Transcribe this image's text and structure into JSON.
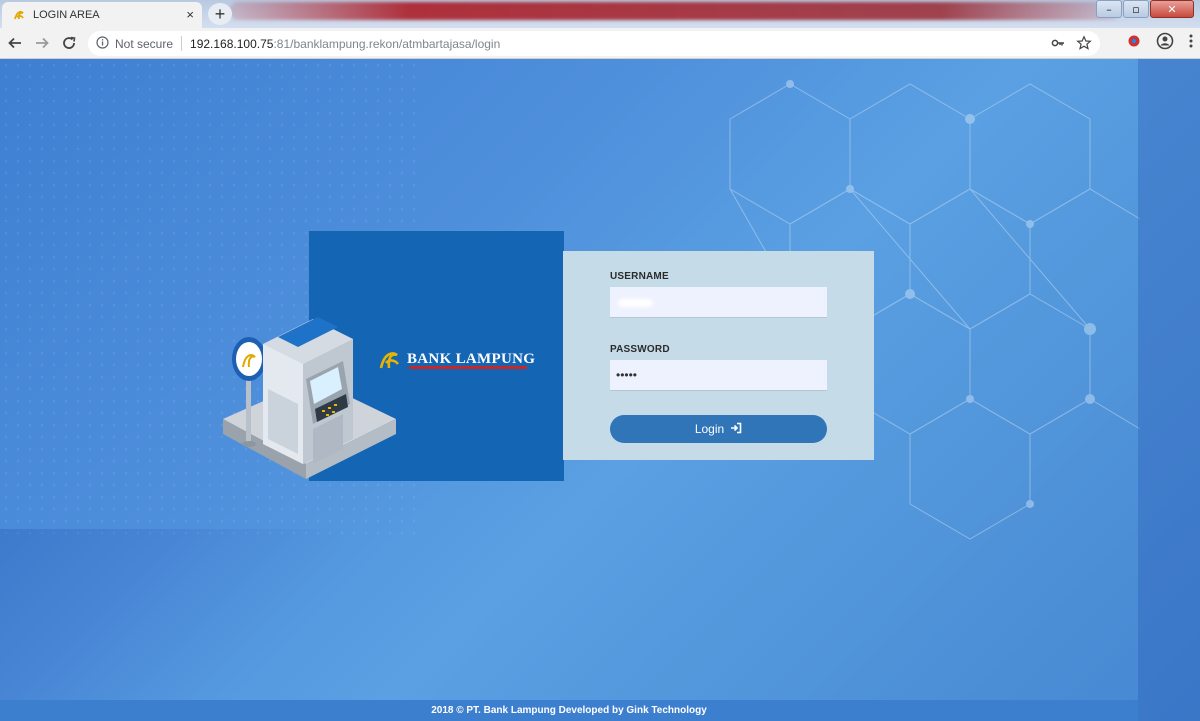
{
  "browser": {
    "tab_title": "LOGIN AREA",
    "tab_close": "×",
    "new_tab": "+",
    "security_label": "Not secure",
    "url_host": "192.168.100.75",
    "url_rest": ":81/banklampung.rekon/atmbartajasa/login",
    "window_controls": {
      "minimize": "–",
      "maximize": "▫",
      "close": "✕"
    }
  },
  "brand": {
    "name": "BANK LAMPUNG"
  },
  "login": {
    "username_label": "USERNAME",
    "password_label": "PASSWORD",
    "password_value": "•••••",
    "button_label": "Login"
  },
  "footer": {
    "text": "2018 © PT. Bank Lampung Developed by Gink Technology"
  },
  "colors": {
    "background": "#4a86d4",
    "brand_panel": "#1565b5",
    "login_panel": "#c5dce8",
    "button": "#2f75b8",
    "input_bg": "#eef1fe"
  }
}
